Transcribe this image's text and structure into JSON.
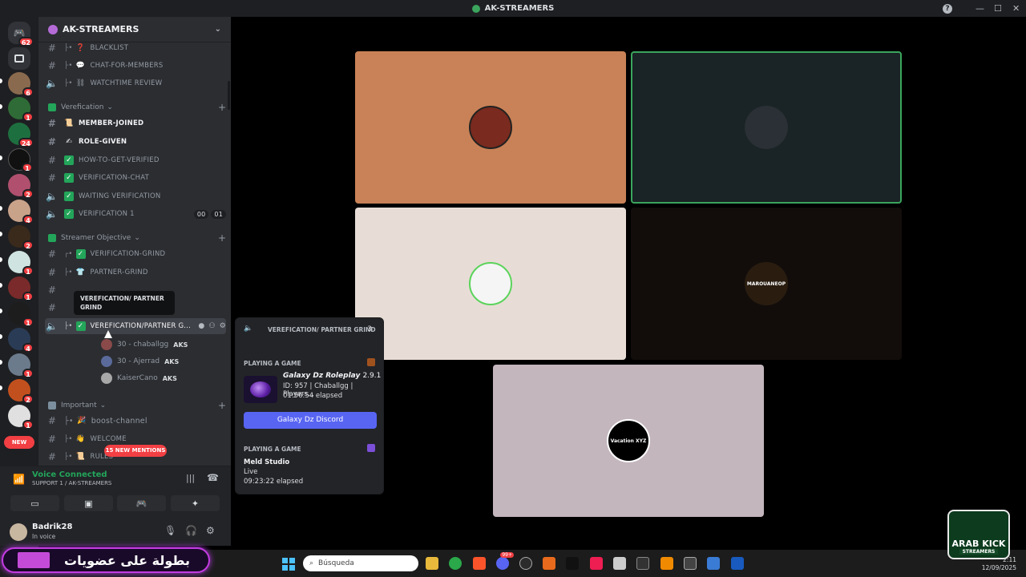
{
  "window": {
    "title": "AK-STREAMERS"
  },
  "servers": {
    "dm_badge": "62",
    "new_label": "NEW",
    "badges": [
      "6",
      "1",
      "24",
      "1",
      "2",
      "4",
      "2",
      "1",
      "1",
      "1",
      "4",
      "1",
      "2",
      "1",
      "2",
      "1"
    ]
  },
  "guild": {
    "name": "AK-STREAMERS"
  },
  "channels": {
    "top": [
      {
        "label": "BLACKLIST",
        "emoji": "❓"
      },
      {
        "label": "CHAT-FOR-MEMBERS",
        "emoji": "💬"
      },
      {
        "label": "WATCHTIME REVIEW",
        "emoji": "⛓"
      }
    ],
    "cat_verify": "Verefication",
    "verify": [
      {
        "label": "MEMBER-JOINED",
        "emoji": "📜"
      },
      {
        "label": "ROLE-GIVEN",
        "emoji": "✍"
      },
      {
        "label": "HOW-TO-GET-VERIFIED",
        "emoji": "✓"
      },
      {
        "label": "VERIFICATION-CHAT",
        "emoji": "✓"
      },
      {
        "label": "WAITING VERIFICATION",
        "emoji": "✓"
      },
      {
        "label": "VERIFICATION 1",
        "emoji": "✓",
        "c1": "00",
        "c2": "01"
      }
    ],
    "cat_objective": "Streamer Objective",
    "objective": [
      {
        "label": "VERIFICATION-GRIND",
        "emoji": "✓"
      },
      {
        "label": "PARTNER-GRIND",
        "emoji": "👕"
      },
      {
        "label": "VEREFICATION/PARTNER G...",
        "emoji": "✓"
      }
    ],
    "tooltip": "VEREFICATION/ PARTNER GRIND",
    "voice_users": [
      {
        "name": "30 - chaballgg",
        "tag": "AKS"
      },
      {
        "name": "30 - Ajerrad",
        "tag": "AKS"
      },
      {
        "name": "KaiserCano",
        "tag": "AKS"
      }
    ],
    "cat_important": "Important",
    "important": [
      {
        "label": "boost-channel",
        "emoji": "🎉"
      },
      {
        "label": "WELCOME",
        "emoji": "👋"
      },
      {
        "label": "RULES",
        "emoji": "📜"
      }
    ],
    "mentions": "15 NEW MENTIONS"
  },
  "voice": {
    "status": "Voice Connected",
    "channel": "SUPPORT 1 / AK-STREAMERS"
  },
  "user": {
    "name": "Badrik28",
    "status": "In voice"
  },
  "tiles": [
    {
      "color": "#c98257"
    },
    {
      "color": "#1a2325"
    },
    {
      "color": "#e8ddd6"
    },
    {
      "color": "#120d0b",
      "caption": "MAROUANEOP"
    },
    {
      "color": "#c4b6bd",
      "caption": "Vacation XYZ"
    }
  ],
  "popout": {
    "header": "VEREFICATION/ PARTNER GRIND",
    "count": "3",
    "playing_label": "PLAYING A GAME",
    "game_title": "Galaxy Dz Roleplay",
    "game_version": "2.9.1",
    "game_detail": "ID: 957 | Chaballgg | Players...",
    "game_elapsed": "01:56:54 elapsed",
    "button": "Galaxy Dz Discord",
    "playing_label2": "PLAYING A GAME",
    "app_name": "Meld Studio",
    "app_state": "Live",
    "app_elapsed": "09:23:22 elapsed"
  },
  "taskbar": {
    "search_placeholder": "Búsqueda",
    "time": "2:11",
    "date": "12/09/2025",
    "badge": "99+"
  },
  "banner": {
    "text": "بطولة على عضويات"
  },
  "brand": {
    "line1": "ARAB KICK",
    "line2": "STREAMERS"
  }
}
